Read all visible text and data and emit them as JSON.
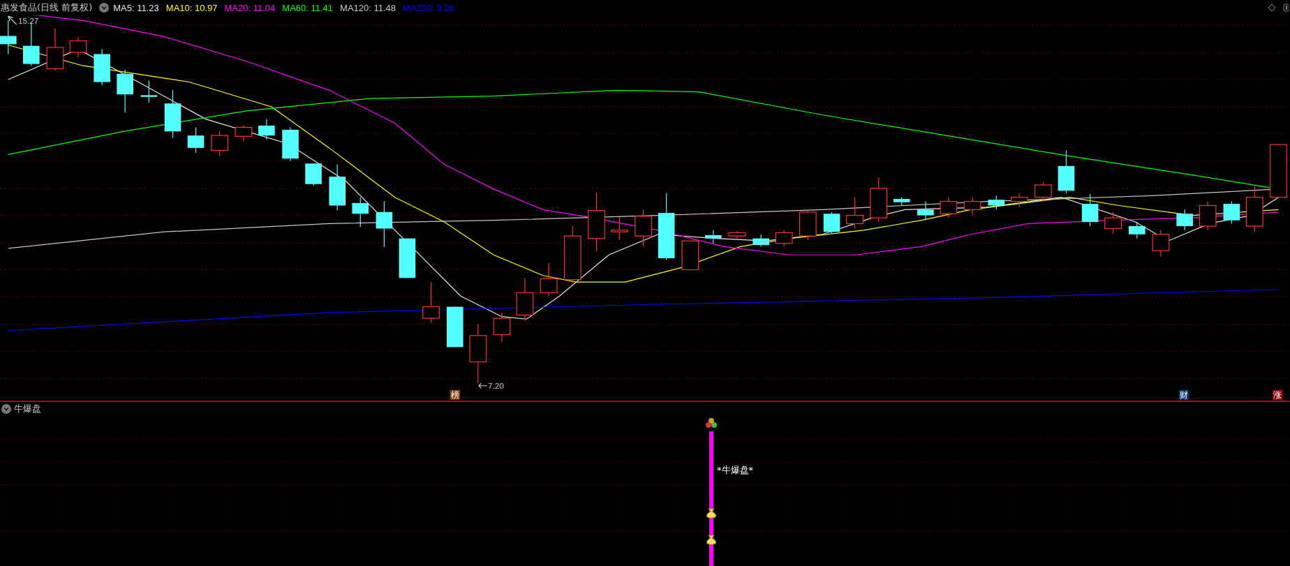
{
  "chart": {
    "stock_title": "惠发食品(日线 前复权)",
    "indicators": [
      {
        "label": "MA5: 11.23",
        "color": "#e8e8e8"
      },
      {
        "label": "MA10: 10.97",
        "color": "#ffff00"
      },
      {
        "label": "MA20: 11.04",
        "color": "#ff00ff"
      },
      {
        "label": "MA60: 11.41",
        "color": "#00ff00"
      },
      {
        "label": "MA120: 11.48",
        "color": "#c8c8c8"
      },
      {
        "label": "MA250: 9.26",
        "color": "#0000ff"
      }
    ],
    "high_label": "15.27",
    "low_label": "7.20",
    "markers": [
      {
        "label": "榜",
        "color": "#8b4513"
      },
      {
        "label": "财",
        "color": "#0b3c7a"
      },
      {
        "label": "涨",
        "color": "#a00000"
      }
    ]
  },
  "sub_panel": {
    "title": "牛爆盘",
    "signal_label": "*牛爆盘*"
  }
}
